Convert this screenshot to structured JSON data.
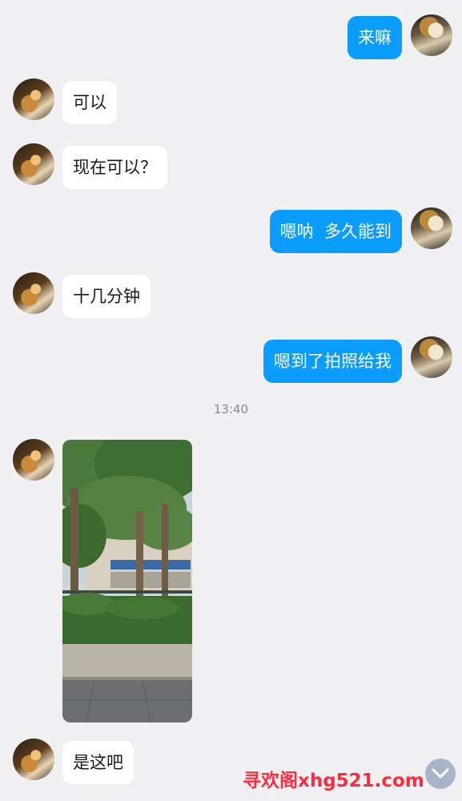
{
  "messages": [
    {
      "sender": "me",
      "text": "来嘛"
    },
    {
      "sender": "them",
      "text": "可以"
    },
    {
      "sender": "them",
      "text": "现在可以？"
    },
    {
      "sender": "me",
      "text": "嗯呐  多久能到"
    },
    {
      "sender": "them",
      "text": "十几分钟"
    },
    {
      "sender": "me",
      "text": "嗯到了拍照给我"
    },
    {
      "sender": "them",
      "text": "是这吧"
    }
  ],
  "timestamp": "13:40",
  "watermark": "寻欢阁xhg521.com",
  "icons": {
    "scroll_down": "chevron-down-icon",
    "photo": "tree-photo"
  },
  "colors": {
    "background": "#f0f0f2",
    "my_bubble": "#0a9cff",
    "their_bubble": "#ffffff",
    "watermark": "#ff2a3d"
  }
}
